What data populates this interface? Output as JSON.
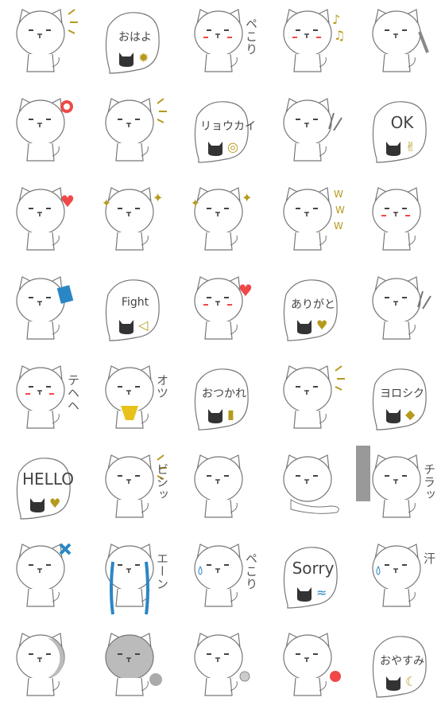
{
  "colors": {
    "line": "#777777",
    "gold": "#b59a1c",
    "red": "#f04848",
    "blue": "#2b86c5",
    "gray": "#999999",
    "black": "#333333",
    "yellow": "#e8c21a"
  },
  "stickers": [
    {
      "type": "cat",
      "accent": "gold-lines"
    },
    {
      "type": "bubble",
      "text": "おはよ",
      "icon": "sun-icon"
    },
    {
      "type": "cat",
      "side": "ペこり",
      "blush": true
    },
    {
      "type": "cat",
      "accent": "music-notes",
      "blush": true
    },
    {
      "type": "cat",
      "accent": "bone"
    },
    {
      "type": "cat",
      "accent": "red-circle"
    },
    {
      "type": "cat",
      "accent": "gold-lines"
    },
    {
      "type": "bubble",
      "text": "リョウカイ",
      "icon": "target-icon"
    },
    {
      "type": "cat",
      "accent": "peace-hand"
    },
    {
      "type": "bubble",
      "text": "OK",
      "icon": "peace-hand-icon",
      "big": true
    },
    {
      "type": "cat",
      "accent": "red-hearts"
    },
    {
      "type": "cat",
      "accent": "sparkles"
    },
    {
      "type": "cat",
      "accent": "sparkles"
    },
    {
      "type": "cat",
      "accent": "www",
      "side": "WWW"
    },
    {
      "type": "cat",
      "blush": true
    },
    {
      "type": "cat",
      "accent": "blue-book"
    },
    {
      "type": "bubble",
      "text": "Fight",
      "icon": "horn-icon"
    },
    {
      "type": "cat",
      "accent": "red-heart",
      "blush": true
    },
    {
      "type": "bubble",
      "text": "ありがと",
      "icon": "hearts-icon"
    },
    {
      "type": "cat",
      "accent": "peace-hand"
    },
    {
      "type": "cat",
      "side": "テヘヘ",
      "blush": true
    },
    {
      "type": "cat",
      "side": "オツ",
      "accent": "yellow-cup"
    },
    {
      "type": "bubble",
      "text": "おつかれ",
      "icon": "beer-icon"
    },
    {
      "type": "cat",
      "accent": "gold-lines"
    },
    {
      "type": "bubble",
      "text": "ヨロシク",
      "icon": "diamonds-icon"
    },
    {
      "type": "bubble",
      "text": "HELLO",
      "icon": "heart-icon",
      "big": true
    },
    {
      "type": "cat",
      "side": "ビシッ",
      "accent": "gold-lines"
    },
    {
      "type": "cat"
    },
    {
      "type": "cat",
      "accent": "lying"
    },
    {
      "type": "cat",
      "side": "チラッ",
      "accent": "wall"
    },
    {
      "type": "cat",
      "accent": "blue-x"
    },
    {
      "type": "cat",
      "side": "エーン",
      "accent": "tears"
    },
    {
      "type": "cat",
      "side": "ペこり",
      "accent": "blue-drop"
    },
    {
      "type": "bubble",
      "text": "Sorry",
      "icon": "blue-drops-icon",
      "big": true
    },
    {
      "type": "cat",
      "side": "汗",
      "accent": "blue-drop"
    },
    {
      "type": "cat",
      "accent": "gray-moon"
    },
    {
      "type": "cat",
      "accent": "gray-shade"
    },
    {
      "type": "cat",
      "accent": "smoke"
    },
    {
      "type": "cat",
      "accent": "red-flower"
    },
    {
      "type": "bubble",
      "text": "おやすみ",
      "icon": "moon-icon"
    }
  ]
}
